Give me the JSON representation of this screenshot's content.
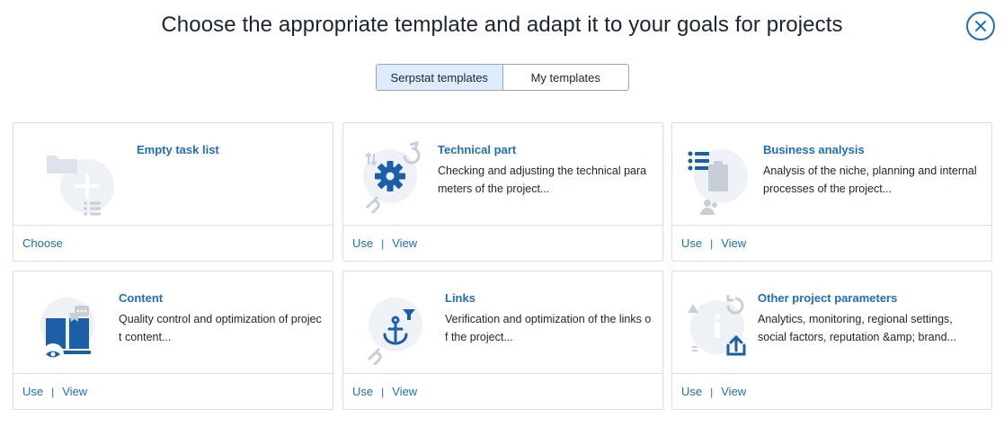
{
  "header": {
    "title": "Choose the appropriate template and adapt it to your goals for projects"
  },
  "tabs": [
    {
      "label": "Serpstat templates",
      "active": true
    },
    {
      "label": "My templates",
      "active": false
    }
  ],
  "cards": [
    {
      "name": "Empty task list",
      "desc": "",
      "actions": [
        "Choose"
      ],
      "icon": "empty-task-list-icon"
    },
    {
      "name": "Technical part",
      "desc": "Checking and adjusting the technical parameters of the project...",
      "actions": [
        "Use",
        "View"
      ],
      "icon": "gear-icon"
    },
    {
      "name": "Business analysis",
      "desc": "Analysis of the niche, planning and internal processes of the project...",
      "actions": [
        "Use",
        "View"
      ],
      "icon": "clipboard-icon"
    },
    {
      "name": "Content",
      "desc": "Quality control and optimization of project content...",
      "actions": [
        "Use",
        "View"
      ],
      "icon": "book-icon"
    },
    {
      "name": "Links",
      "desc": "Verification and optimization of the links of the project...",
      "actions": [
        "Use",
        "View"
      ],
      "icon": "anchor-icon"
    },
    {
      "name": "Other project parameters",
      "desc": "Analytics, monitoring, regional settings, social factors, reputation &amp; brand...",
      "actions": [
        "Use",
        "View"
      ],
      "icon": "info-icon"
    }
  ],
  "colors": {
    "accent": "#1f6fb8",
    "tab_active_bg": "#dcecfb",
    "border": "#d9dee4",
    "illustration_bg": "#eef1f5"
  }
}
